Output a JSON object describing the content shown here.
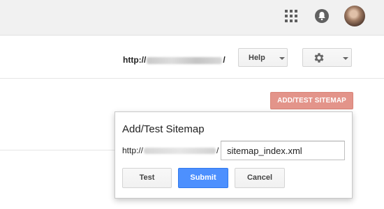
{
  "topbar": {
    "icons": [
      "apps-grid-icon",
      "notifications-icon",
      "user-avatar"
    ]
  },
  "header": {
    "site_url_prefix": "http://",
    "site_url_suffix": "/",
    "help_label": "Help",
    "settings_icon": "gear-icon"
  },
  "actions": {
    "add_test_sitemap_label": "ADD/TEST SITEMAP"
  },
  "dialog": {
    "title": "Add/Test Sitemap",
    "url_prefix": "http://",
    "url_suffix": "/",
    "input_value": "sitemap_index.xml",
    "test_label": "Test",
    "submit_label": "Submit",
    "cancel_label": "Cancel"
  },
  "colors": {
    "topbar_bg": "#f1f1f1",
    "add_sitemap_bg": "#e3948a",
    "submit_bg": "#4d90fe"
  }
}
